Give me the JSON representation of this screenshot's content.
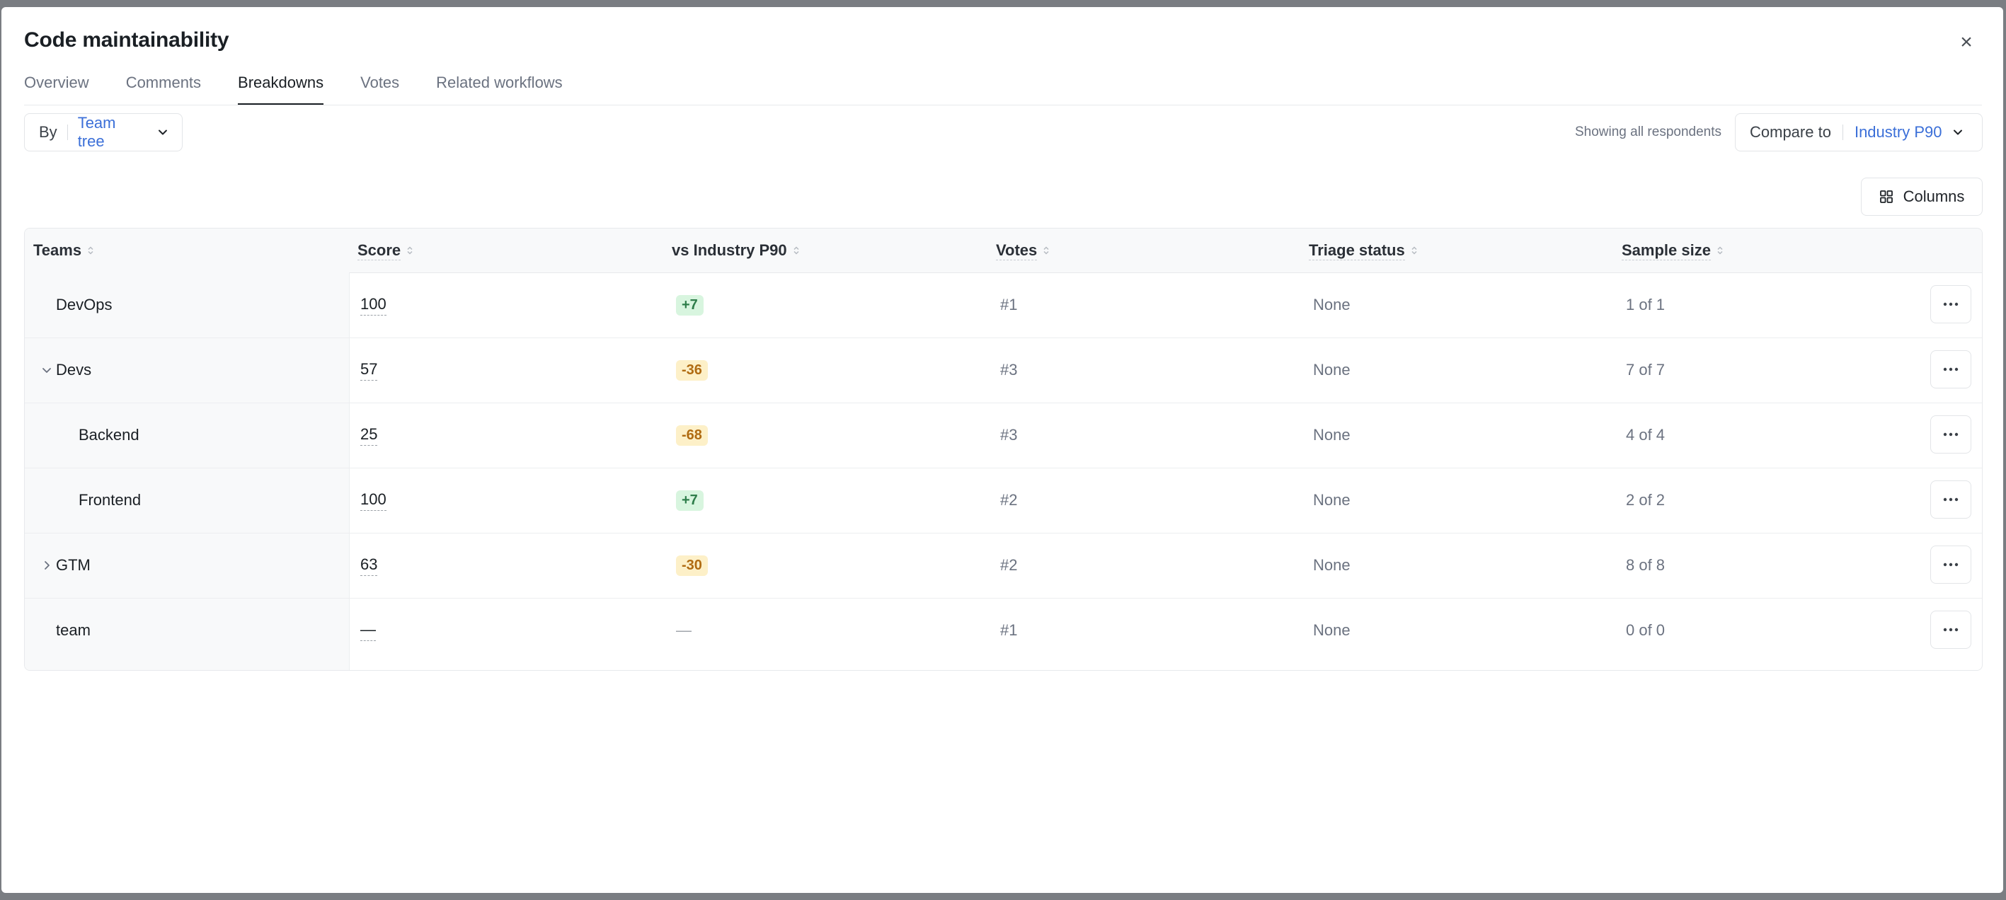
{
  "modal": {
    "title": "Code maintainability",
    "close_glyph": "×"
  },
  "tabs": [
    {
      "label": "Overview",
      "active": false
    },
    {
      "label": "Comments",
      "active": false
    },
    {
      "label": "Breakdowns",
      "active": true
    },
    {
      "label": "Votes",
      "active": false
    },
    {
      "label": "Related workflows",
      "active": false
    }
  ],
  "filters": {
    "by_label": "By",
    "by_value": "Team tree",
    "showing_text": "Showing all respondents",
    "compare_label": "Compare to",
    "compare_value": "Industry P90",
    "columns_label": "Columns"
  },
  "table": {
    "headers": {
      "teams": "Teams",
      "score": "Score",
      "vs": "vs Industry P90",
      "votes": "Votes",
      "triage": "Triage status",
      "sample": "Sample size"
    },
    "rows": [
      {
        "team": "DevOps",
        "score": "100",
        "vs": "+7",
        "vs_kind": "pos",
        "votes": "#1",
        "triage": "None",
        "sample": "1 of 1",
        "expander": "none",
        "indent": 1
      },
      {
        "team": "Devs",
        "score": "57",
        "vs": "-36",
        "vs_kind": "neg",
        "votes": "#3",
        "triage": "None",
        "sample": "7 of 7",
        "expander": "expanded",
        "indent": 1
      },
      {
        "team": "Backend",
        "score": "25",
        "vs": "-68",
        "vs_kind": "neg",
        "votes": "#3",
        "triage": "None",
        "sample": "4 of 4",
        "expander": "none",
        "indent": 2
      },
      {
        "team": "Frontend",
        "score": "100",
        "vs": "+7",
        "vs_kind": "pos",
        "votes": "#2",
        "triage": "None",
        "sample": "2 of 2",
        "expander": "none",
        "indent": 2
      },
      {
        "team": "GTM",
        "score": "63",
        "vs": "-30",
        "vs_kind": "neg",
        "votes": "#2",
        "triage": "None",
        "sample": "8 of 8",
        "expander": "collapsed",
        "indent": 1
      },
      {
        "team": "team",
        "score": "—",
        "vs": "—",
        "vs_kind": "none",
        "votes": "#1",
        "triage": "None",
        "sample": "0 of 0",
        "expander": "none",
        "indent": 1
      }
    ]
  },
  "colors": {
    "accent": "#3b6fd8",
    "positive_bg": "#d8f5df",
    "positive_fg": "#2e7d4a",
    "negative_bg": "#fdf0c8",
    "negative_fg": "#b06b12"
  },
  "icons": {
    "close": "close-icon",
    "chevron": "chevron-down-icon",
    "columns": "grid-icon",
    "sort": "sort-icon",
    "more": "more-horizontal-icon"
  }
}
